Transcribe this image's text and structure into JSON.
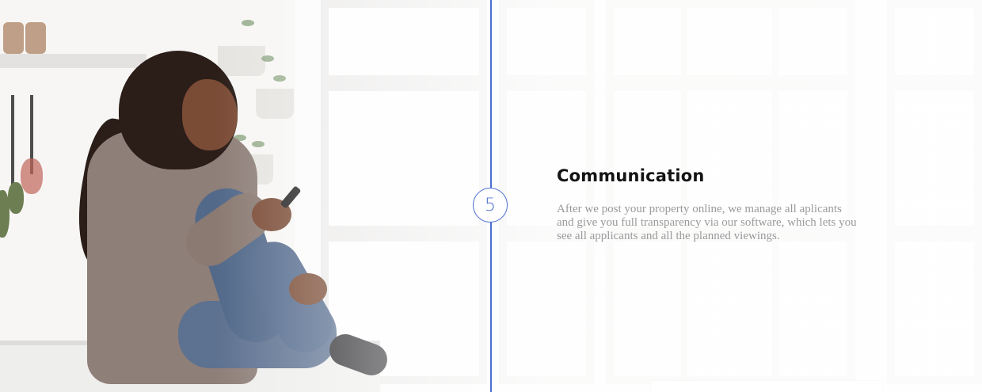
{
  "step": {
    "number": "5",
    "title": "Communication",
    "description": "After we post your property online, we manage all aplicants and give you full transparency via our software, which lets you see all applicants and all the planned viewings."
  },
  "colors": {
    "accent": "#4b6fd0",
    "title": "#141414",
    "text": "#9a9a9a"
  }
}
